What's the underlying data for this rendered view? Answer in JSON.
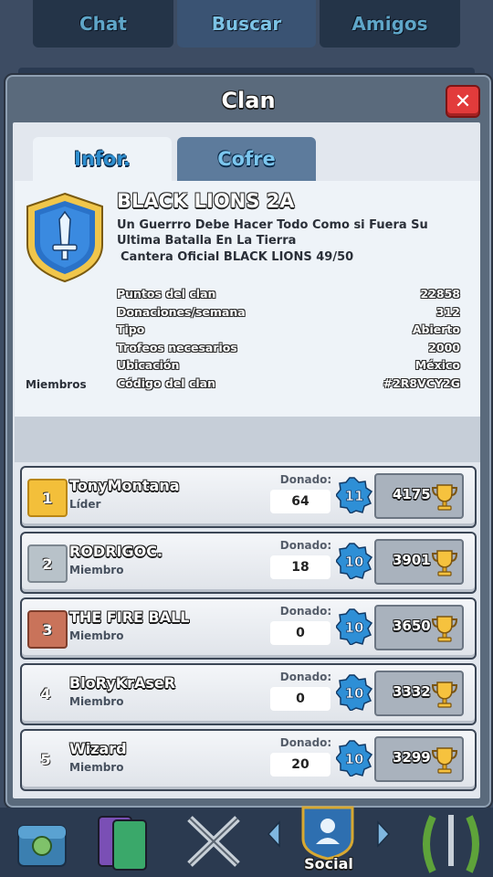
{
  "top_tabs": [
    "Chat",
    "Buscar",
    "Amigos"
  ],
  "modal": {
    "title": "Clan",
    "tabs": {
      "info": "Infor.",
      "chest": "Cofre"
    }
  },
  "clan": {
    "name": "BLACK LIONS 2A",
    "description": "Un Guerrro Debe Hacer Todo Como si Fuera Su Ultima Batalla En La Tierra",
    "description2": "Cantera Oficial BLACK LIONS 49/50",
    "stats": [
      {
        "label": "Puntos del clan",
        "value": "22858"
      },
      {
        "label": "Donaciones/semana",
        "value": "312"
      },
      {
        "label": "Tipo",
        "value": "Abierto"
      },
      {
        "label": "Trofeos necesarios",
        "value": "2000"
      },
      {
        "label": "Ubicación",
        "value": "México"
      },
      {
        "label": "Código del clan",
        "value": "#2R8VCY2G"
      }
    ],
    "members_label": "Miembros"
  },
  "donated_label": "Donado:",
  "members": [
    {
      "rank": "1",
      "name": "TonyMontana",
      "role": "Líder",
      "donated": "64",
      "level": "11",
      "trophies": "4175"
    },
    {
      "rank": "2",
      "name": "RODRIGOC.",
      "role": "Miembro",
      "donated": "18",
      "level": "10",
      "trophies": "3901"
    },
    {
      "rank": "3",
      "name": "THE FIRE BALL",
      "role": "Miembro",
      "donated": "0",
      "level": "10",
      "trophies": "3650"
    },
    {
      "rank": "4",
      "name": "BloRyKrAseR",
      "role": "Miembro",
      "donated": "0",
      "level": "10",
      "trophies": "3332"
    },
    {
      "rank": "5",
      "name": "Wizard",
      "role": "Miembro",
      "donated": "20",
      "level": "10",
      "trophies": "3299"
    }
  ],
  "bottom_nav": {
    "active_label": "Social"
  },
  "colors": {
    "gold": "#f3bf3a",
    "silver": "#b8c2c9",
    "bronze": "#c9735a",
    "level_badge": "#2e8fd6"
  }
}
